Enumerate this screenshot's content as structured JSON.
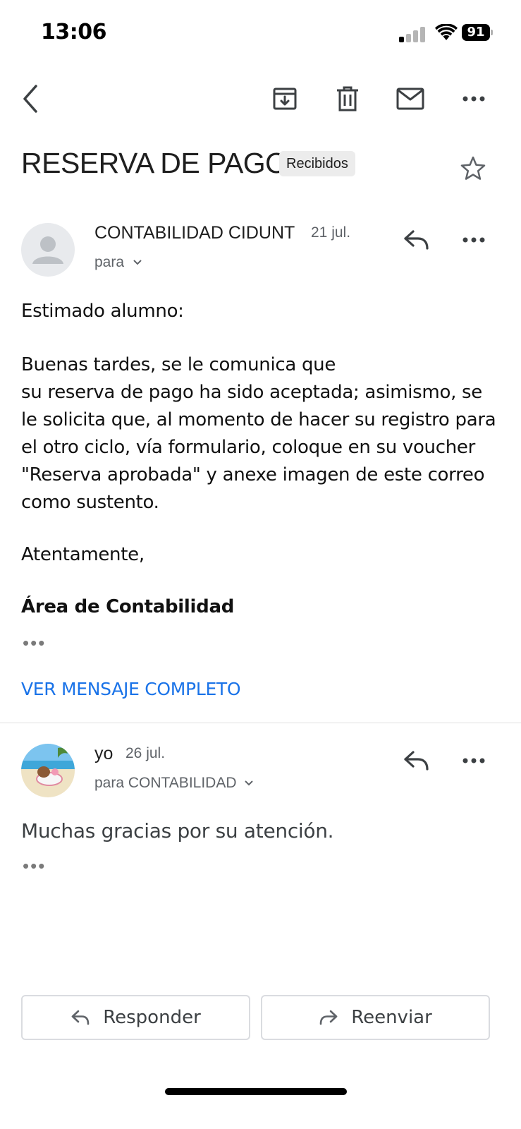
{
  "status_bar": {
    "time": "13:06",
    "battery": "91"
  },
  "toolbar": {
    "icons": [
      "back-arrow-icon",
      "archive-icon",
      "trash-icon",
      "mail-icon",
      "more-icon"
    ]
  },
  "email": {
    "subject": "RESERVA DE PAGO",
    "label": "Recibidos"
  },
  "messages": [
    {
      "sender": "CONTABILIDAD CIDUNT",
      "date": "21 jul.",
      "to": "para",
      "greeting": "Estimado alumno:",
      "paragraph_lines": [
        "Buenas tardes, se le comunica que",
        "su reserva de pago ha sido aceptada; asimismo, se",
        "le solicita que, al momento de hacer su registro para",
        "el otro ciclo, vía formulario, coloque en su voucher",
        "\"Reserva aprobada\" y anexe imagen de este correo",
        "como sustento."
      ],
      "closing": "Atentamente,",
      "signature": "Área de Contabilidad",
      "ellipsis": "•••",
      "view_full": "VER MENSAJE COMPLETO"
    },
    {
      "sender": "yo",
      "date": "26 jul.",
      "to": "para CONTABILIDAD",
      "body": "Muchas gracias por su atención.",
      "ellipsis": "•••"
    }
  ],
  "actions": {
    "reply": "Responder",
    "forward": "Reenviar"
  },
  "colors": {
    "link": "#1a73e8",
    "muted": "#5f6368",
    "chip_bg": "#ececec"
  }
}
